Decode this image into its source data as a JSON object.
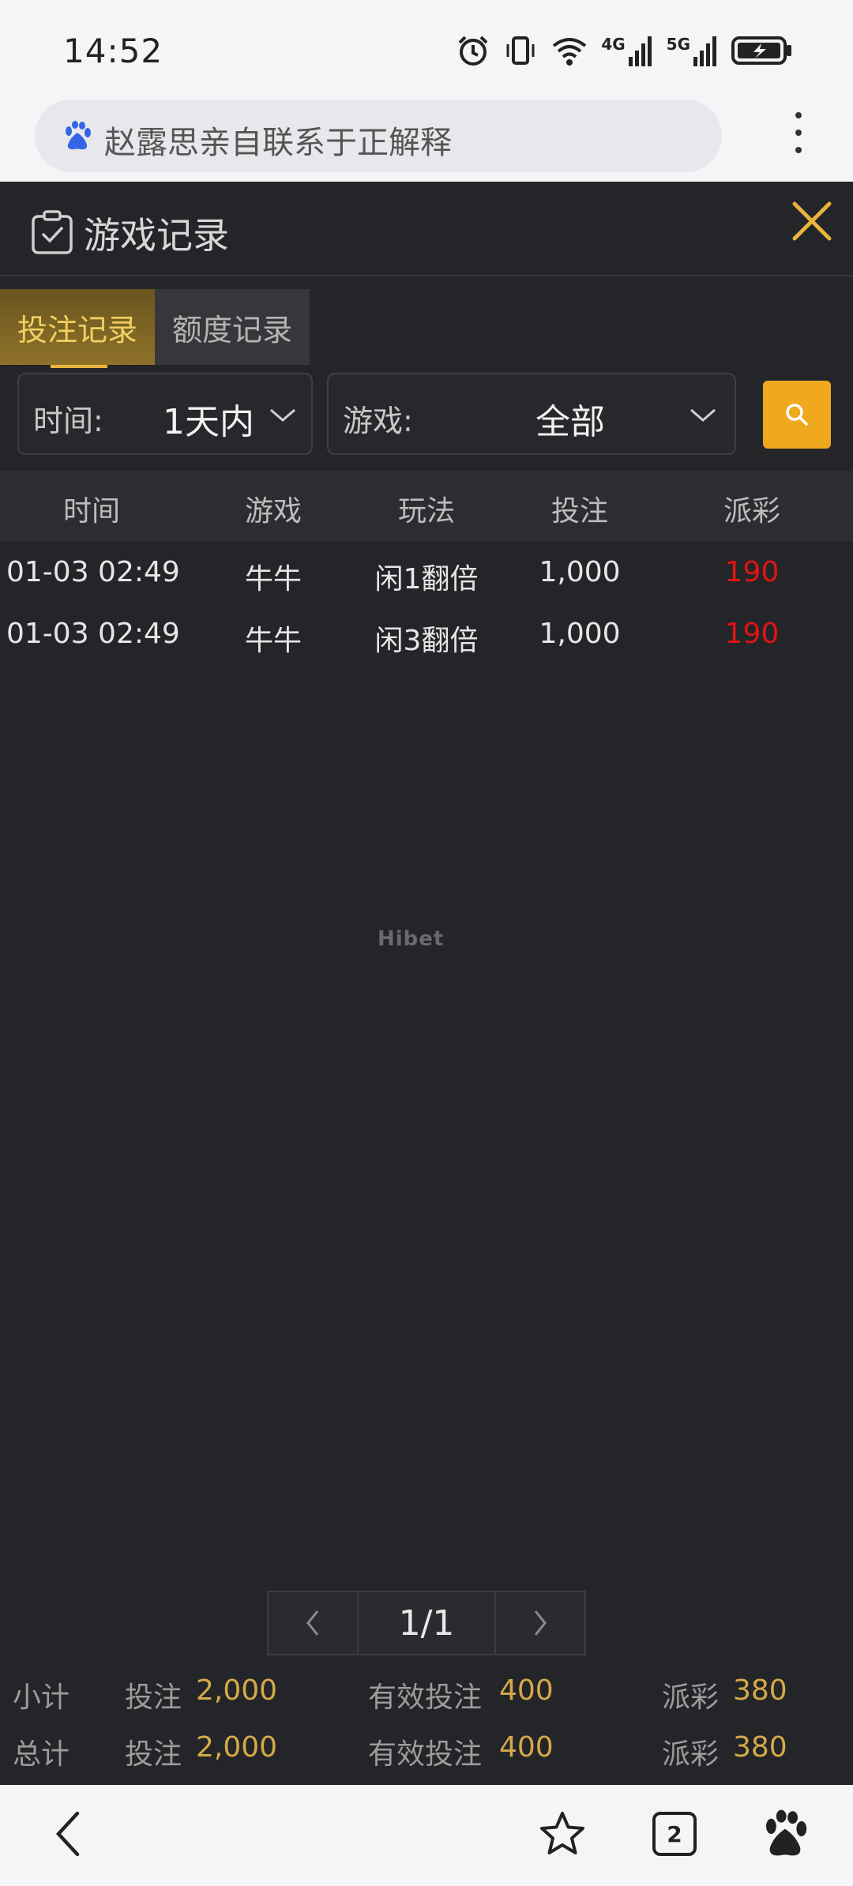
{
  "status": {
    "time": "14:52",
    "net1": "4G",
    "net2": "5G"
  },
  "browser": {
    "url_text": "赵露思亲自联系于正解释",
    "tabs_count": "2"
  },
  "panel": {
    "title": "游戏记录",
    "tabs": [
      {
        "label": "投注记录",
        "active": true
      },
      {
        "label": "额度记录",
        "active": false
      }
    ],
    "filters": {
      "time_label": "时间:",
      "time_value": "1天内",
      "game_label": "游戏:",
      "game_value": "全部"
    },
    "table": {
      "headers": [
        "时间",
        "游戏",
        "玩法",
        "投注",
        "派彩"
      ],
      "rows": [
        {
          "time": "01-03 02:49",
          "game": "牛牛",
          "play": "闲1翻倍",
          "bet": "1,000",
          "payout": "190"
        },
        {
          "time": "01-03 02:49",
          "game": "牛牛",
          "play": "闲3翻倍",
          "bet": "1,000",
          "payout": "190"
        }
      ]
    },
    "watermark": "Hibet",
    "pagination": {
      "page": "1/1"
    },
    "summary": [
      {
        "label": "小计",
        "bet_label": "投注",
        "bet": "2,000",
        "valid_label": "有效投注",
        "valid": "400",
        "payout_label": "派彩",
        "payout": "380"
      },
      {
        "label": "总计",
        "bet_label": "投注",
        "bet": "2,000",
        "valid_label": "有效投注",
        "valid": "400",
        "payout_label": "派彩",
        "payout": "380"
      }
    ]
  },
  "colors": {
    "accent": "#f0a81e",
    "payout_red": "#e01414",
    "panel_bg": "#242528",
    "summary_value": "#d4a94a"
  }
}
